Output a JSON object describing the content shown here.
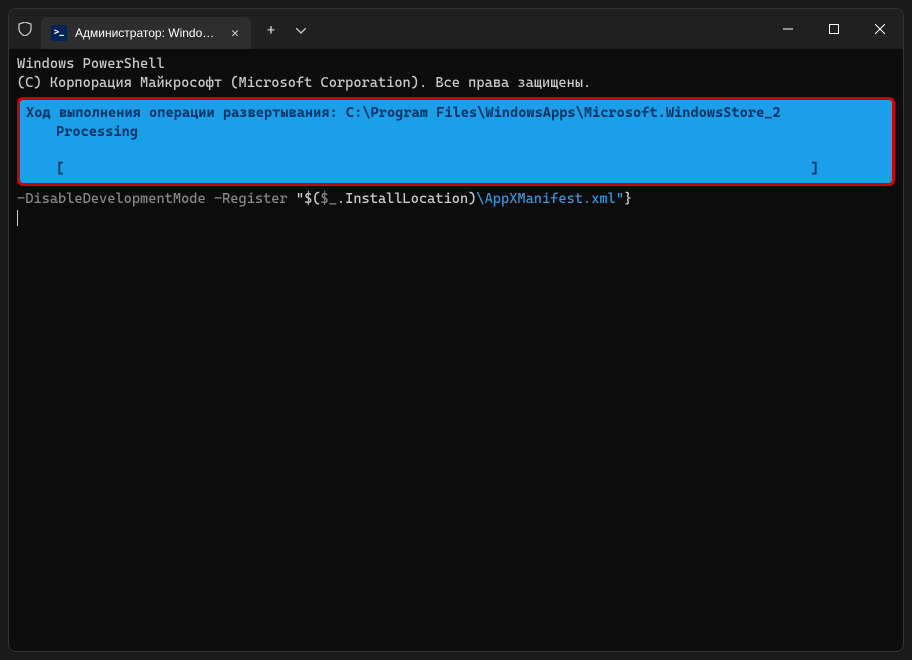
{
  "tab": {
    "title": "Администратор: Windows Po"
  },
  "terminal": {
    "line1": "Windows PowerShell",
    "line2": "(C) Корпорация Майкрософт (Microsoft Corporation). Все права защищены.",
    "progress": {
      "line1": "Ход выполнения операции развертывания: C:\\Program Files\\WindowsApps\\Microsoft.WindowsStore_2",
      "line2": "Processing",
      "bar_open": "[",
      "bar_close": "]"
    },
    "cmd": {
      "part1": "-DisableDevelopmentMode -Register ",
      "part2": "\"$(",
      "part3": "$_",
      "part4": ".InstallLocation",
      "part5": ")",
      "part6": "\\AppXManifest.xml\"",
      "part7": "}"
    }
  }
}
